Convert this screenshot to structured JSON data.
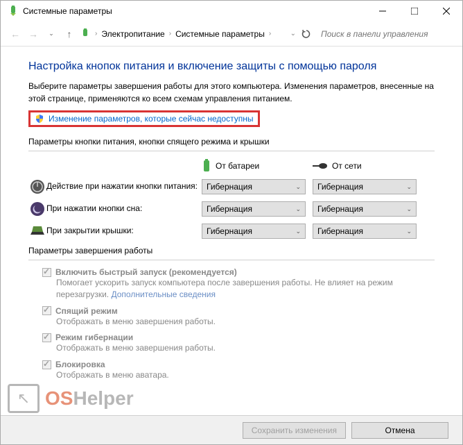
{
  "window": {
    "title": "Системные параметры"
  },
  "breadcrumb": {
    "item1": "Электропитание",
    "item2": "Системные параметры"
  },
  "search": {
    "placeholder": "Поиск в панели управления"
  },
  "heading": "Настройка кнопок питания и включение защиты с помощью пароля",
  "description": "Выберите параметры завершения работы для этого компьютера. Изменения параметров, внесенные на этой странице, применяются ко всем схемам управления питанием.",
  "admin_link": "Изменение параметров, которые сейчас недоступны",
  "section_power_buttons": "Параметры кнопки питания, кнопки спящего режима и крышки",
  "columns": {
    "battery": "От батареи",
    "ac": "От сети"
  },
  "rows": {
    "power_button": {
      "label": "Действие при нажатии кнопки питания:",
      "battery": "Гибернация",
      "ac": "Гибернация"
    },
    "sleep_button": {
      "label": "При нажатии кнопки сна:",
      "battery": "Гибернация",
      "ac": "Гибернация"
    },
    "lid_close": {
      "label": "При закрытии крышки:",
      "battery": "Гибернация",
      "ac": "Гибернация"
    }
  },
  "section_shutdown": "Параметры завершения работы",
  "shutdown_options": {
    "fast_startup": {
      "label": "Включить быстрый запуск (рекомендуется)",
      "desc": "Помогает ускорить запуск компьютера после завершения работы. Не влияет на режим перезагрузки.",
      "link": "Дополнительные сведения"
    },
    "sleep": {
      "label": "Спящий режим",
      "desc": "Отображать в меню завершения работы."
    },
    "hibernate": {
      "label": "Режим гибернации",
      "desc": "Отображать в меню завершения работы."
    },
    "lock": {
      "label": "Блокировка",
      "desc": "Отображать в меню аватара."
    }
  },
  "footer": {
    "save": "Сохранить изменения",
    "cancel": "Отмена"
  },
  "watermark": {
    "os": "OS",
    "helper": "Helper"
  }
}
